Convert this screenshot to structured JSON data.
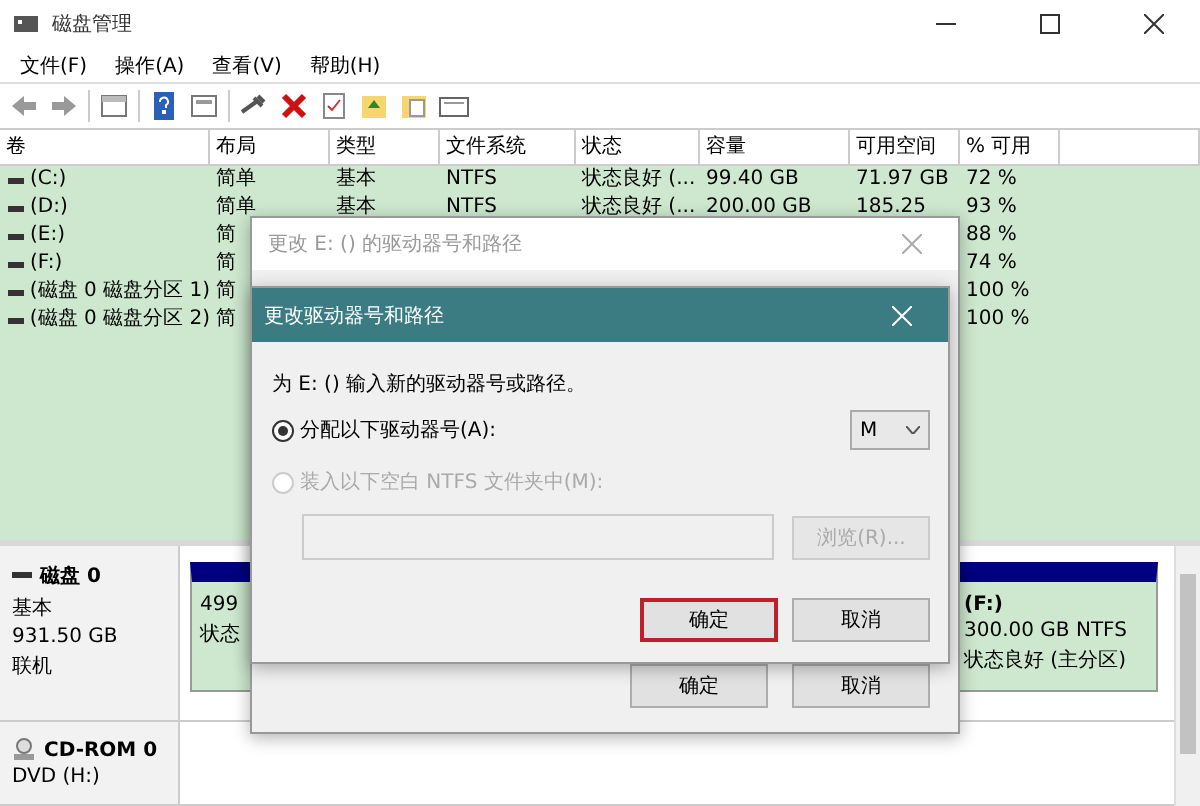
{
  "window": {
    "title": "磁盘管理"
  },
  "menu": [
    {
      "label": "文件(F)"
    },
    {
      "label": "操作(A)"
    },
    {
      "label": "查看(V)"
    },
    {
      "label": "帮助(H)"
    }
  ],
  "volume_table": {
    "columns": [
      "卷",
      "布局",
      "类型",
      "文件系统",
      "状态",
      "容量",
      "可用空间",
      "% 可用"
    ],
    "rows": [
      {
        "volume": "(C:)",
        "layout": "简单",
        "type": "基本",
        "fs": "NTFS",
        "status": "状态良好 (...",
        "capacity": "99.40 GB",
        "free": "71.97 GB",
        "pct": "72 %"
      },
      {
        "volume": "(D:)",
        "layout": "简单",
        "type": "基本",
        "fs": "NTFS",
        "status": "状态良好 (...",
        "capacity": "200.00 GB",
        "free": "185.25",
        "pct": "93 %"
      },
      {
        "volume": "(E:)",
        "layout": "简",
        "pct": "88 %"
      },
      {
        "volume": "(F:)",
        "layout": "简",
        "pct": "74 %"
      },
      {
        "volume": "(磁盘 0 磁盘分区 1)",
        "layout": "简",
        "pct": "100 %"
      },
      {
        "volume": "(磁盘 0 磁盘分区 2)",
        "layout": "简",
        "pct": "100 %"
      }
    ]
  },
  "disks": [
    {
      "kind": "disk",
      "name": "磁盘 0",
      "lines": [
        "基本",
        "931.50 GB",
        "联机"
      ],
      "partitions": [
        {
          "lines": [
            "499",
            "状态"
          ]
        },
        {
          "title": "(F:)",
          "lines": [
            "300.00 GB NTFS",
            "状态良好 (主分区)"
          ]
        }
      ]
    },
    {
      "kind": "cdrom",
      "name": "CD-ROM 0",
      "lines": [
        "DVD (H:)"
      ]
    }
  ],
  "back_dialog": {
    "title": "更改 E: () 的驱动器号和路径",
    "buttons": [
      "确定",
      "取消"
    ]
  },
  "dialog": {
    "title": "更改驱动器号和路径",
    "prompt": "为 E: () 输入新的驱动器号或路径。",
    "options": [
      {
        "label": "分配以下驱动器号(A):",
        "selected": true,
        "disabled": false
      },
      {
        "label": "装入以下空白 NTFS 文件夹中(M):",
        "selected": false,
        "disabled": true
      }
    ],
    "drive_letter": "M",
    "path_field": {
      "disabled": true
    },
    "browse_button": {
      "label": "浏览(R)...",
      "disabled": true
    },
    "buttons": [
      {
        "label": "确定",
        "highlighted": true
      },
      {
        "label": "取消",
        "highlighted": false
      }
    ]
  }
}
